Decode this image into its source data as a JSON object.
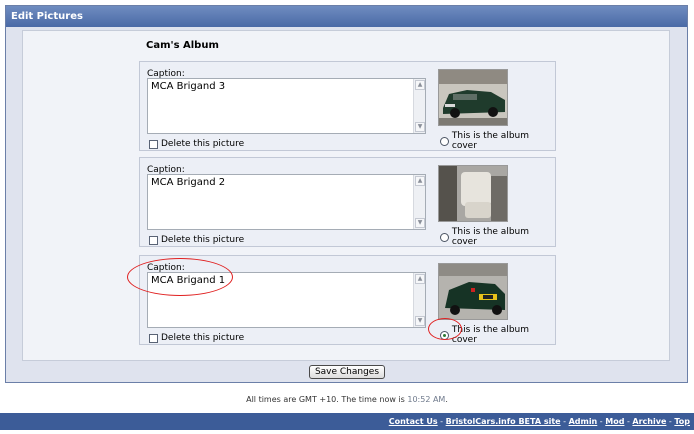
{
  "panel": {
    "title": "Edit Pictures"
  },
  "album": {
    "title": "Cam's Album"
  },
  "pictures": [
    {
      "caption_label": "Caption:",
      "caption": "MCA Brigand 3",
      "delete_label": "Delete this picture",
      "cover_label": "This is the album cover",
      "is_cover": false
    },
    {
      "caption_label": "Caption:",
      "caption": "MCA Brigand 2",
      "delete_label": "Delete this picture",
      "cover_label": "This is the album cover",
      "is_cover": false
    },
    {
      "caption_label": "Caption:",
      "caption": "MCA Brigand 1",
      "delete_label": "Delete this picture",
      "cover_label": "This is the album cover",
      "is_cover": true
    }
  ],
  "save_button": "Save Changes",
  "timezone": {
    "prefix": "All times are GMT +10. The time now is ",
    "time": "10:52 AM",
    "suffix": "."
  },
  "footer": {
    "links": [
      "Contact Us",
      "BristolCars.info BETA site",
      "Admin",
      "Mod",
      "Archive",
      "Top"
    ],
    "separator": " - "
  },
  "colors": {
    "header": "#4a6aa6",
    "footer": "#3c5c98",
    "annotation": "#e02020"
  }
}
